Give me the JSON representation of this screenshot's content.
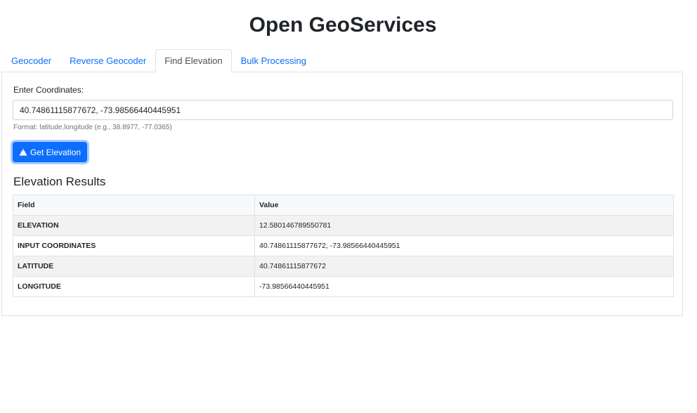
{
  "app": {
    "title": "Open GeoServices"
  },
  "tabs": [
    {
      "label": "Geocoder",
      "active": false
    },
    {
      "label": "Reverse Geocoder",
      "active": false
    },
    {
      "label": "Find Elevation",
      "active": true
    },
    {
      "label": "Bulk Processing",
      "active": false
    }
  ],
  "form": {
    "label": "Enter Coordinates:",
    "value": "40.74861115877672, -73.98566440445951",
    "hint": "Format: latitude,longitude (e.g., 38.8977, -77.0365)",
    "button_label": "Get Elevation",
    "button_icon": "mountain-icon"
  },
  "results": {
    "title": "Elevation Results",
    "headers": [
      "Field",
      "Value"
    ],
    "rows": [
      {
        "field": "ELEVATION",
        "value": "12.580146789550781"
      },
      {
        "field": "INPUT COORDINATES",
        "value": "40.74861115877672, -73.98566440445951"
      },
      {
        "field": "LATITUDE",
        "value": "40.74861115877672"
      },
      {
        "field": "LONGITUDE",
        "value": "-73.98566440445951"
      }
    ]
  },
  "colors": {
    "accent": "#0d6efd",
    "text": "#212529",
    "muted": "#6c757d",
    "border": "#dee2e6"
  }
}
